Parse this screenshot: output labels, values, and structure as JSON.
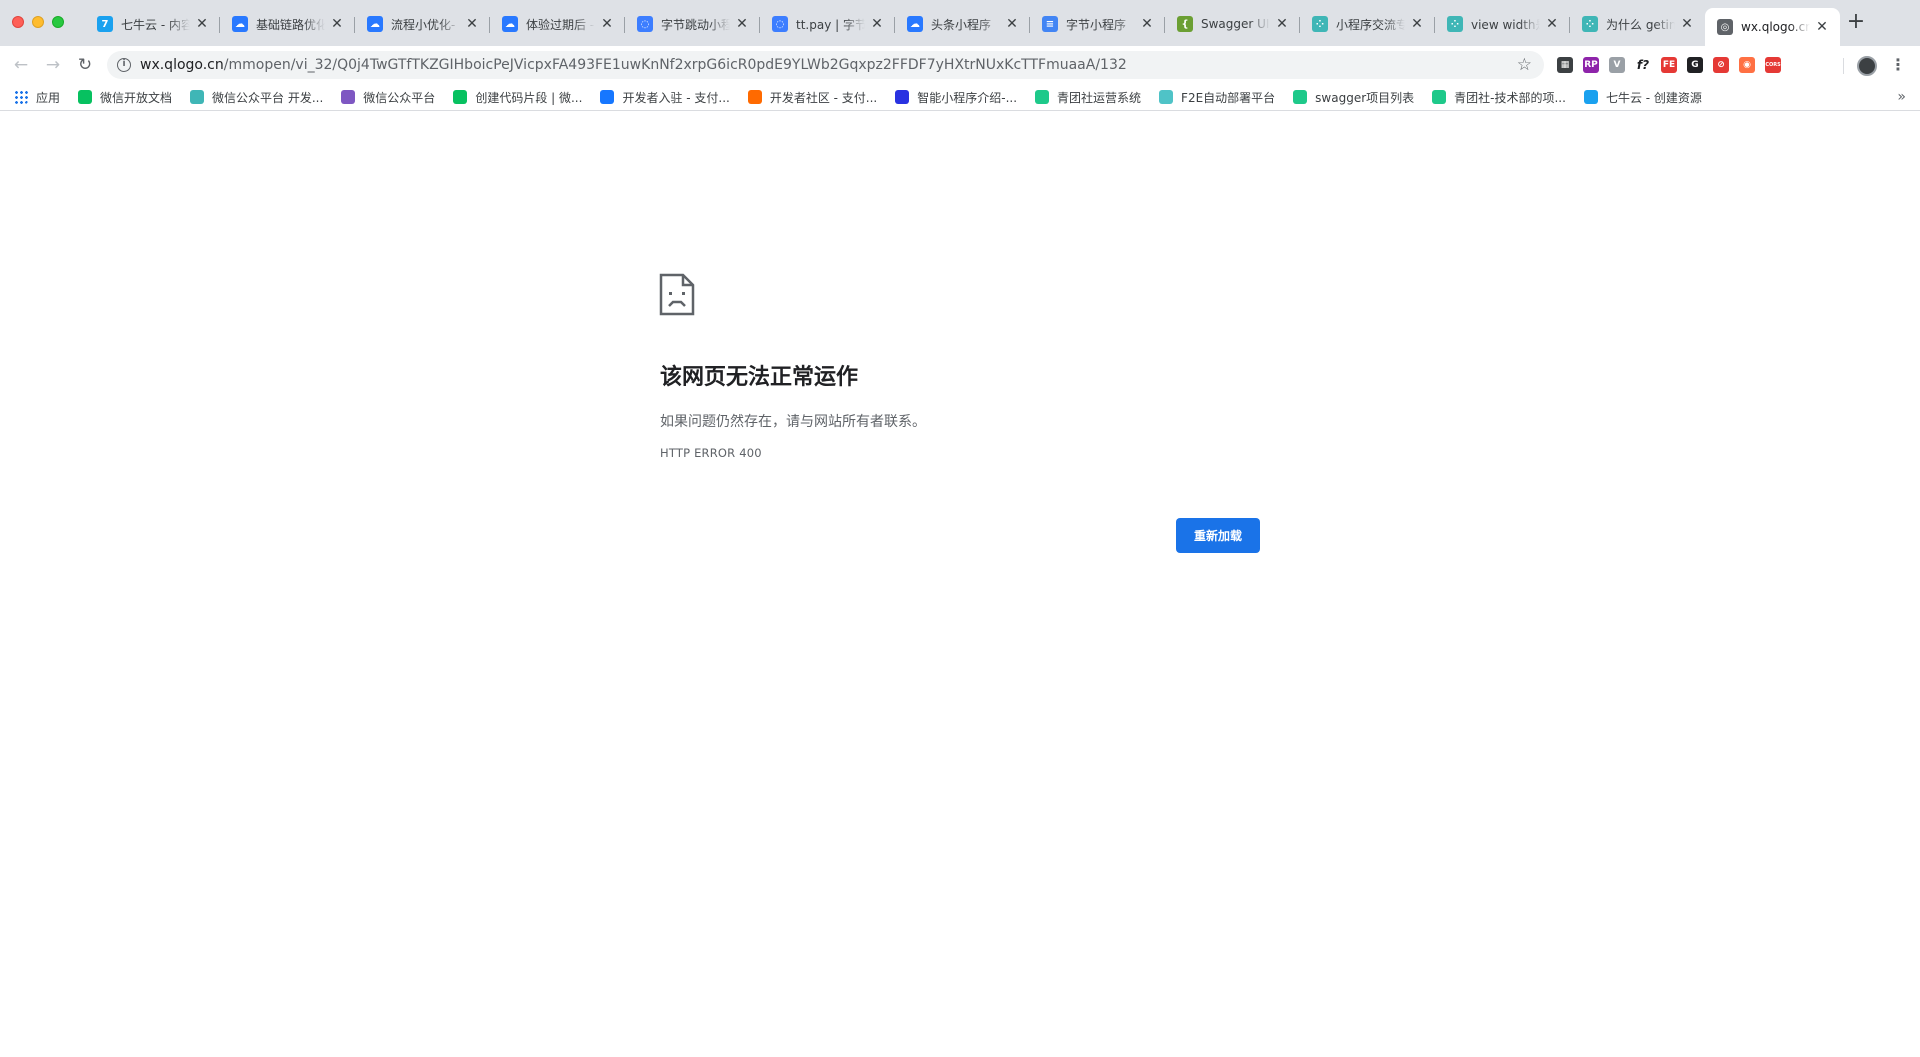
{
  "tabs": [
    {
      "title": "七牛云 - 内容",
      "fav_color": "#1aa1ef",
      "fav_glyph": "7"
    },
    {
      "title": "基础链路优化",
      "fav_color": "#2979ff",
      "fav_glyph": "☁"
    },
    {
      "title": "流程小优化-",
      "fav_color": "#2979ff",
      "fav_glyph": "☁"
    },
    {
      "title": "体验过期后 -",
      "fav_color": "#2979ff",
      "fav_glyph": "☁"
    },
    {
      "title": "字节跳动小程",
      "fav_color": "#3d7eff",
      "fav_glyph": "◌"
    },
    {
      "title": "tt.pay | 字节",
      "fav_color": "#3d7eff",
      "fav_glyph": "◌"
    },
    {
      "title": "头条小程序",
      "fav_color": "#2979ff",
      "fav_glyph": "☁"
    },
    {
      "title": "字节小程序",
      "fav_color": "#4285f4",
      "fav_glyph": "≡"
    },
    {
      "title": "Swagger UI",
      "fav_color": "#6b9f33",
      "fav_glyph": "{"
    },
    {
      "title": "小程序交流专",
      "fav_color": "#3fb6b6",
      "fav_glyph": "⁘"
    },
    {
      "title": "view width是",
      "fav_color": "#3fb6b6",
      "fav_glyph": "⁘"
    },
    {
      "title": "为什么 getin",
      "fav_color": "#3fb6b6",
      "fav_glyph": "⁘"
    },
    {
      "title": "wx.qlogo.cn",
      "fav_color": "#5f6368",
      "fav_glyph": "◎",
      "active": true
    }
  ],
  "close_glyph": "✕",
  "newtab_glyph": "+",
  "nav": {
    "back": "←",
    "forward": "→",
    "reload": "↻"
  },
  "omnibox": {
    "info_glyph": "i",
    "host": "wx.qlogo.cn",
    "path": "/mmopen/vi_32/Q0j4TwGTfTKZGIHboicPeJVicpxFA493FE1uwKnNf2xrpG6icR0pdE9YLWb2Gqxpz2FFDF7yHXtrNUxKcTTFmuaaA/132",
    "star_glyph": "☆"
  },
  "extensions": [
    {
      "name": "qr-code-extension-icon",
      "color": "#3c4043",
      "glyph": "▦"
    },
    {
      "name": "rp-extension-icon",
      "color": "#8e24aa",
      "glyph": "RP"
    },
    {
      "name": "vue-devtools-extension-icon",
      "color": "#9aa0a6",
      "glyph": "V"
    },
    {
      "name": "function-extension-icon",
      "color": "#ffffff",
      "glyph": "f?"
    },
    {
      "name": "fe-helper-extension-icon",
      "color": "#e53935",
      "glyph": "FE"
    },
    {
      "name": "dark-circle-extension-icon",
      "color": "#202124",
      "glyph": "G"
    },
    {
      "name": "red-circle-extension-icon",
      "color": "#e53935",
      "glyph": "⊘"
    },
    {
      "name": "orange-circle-extension-icon",
      "color": "#ff7043",
      "glyph": "◉"
    },
    {
      "name": "cors-extension-icon",
      "color": "#e53935",
      "glyph": "CORS"
    }
  ],
  "menu_glyph": "⋮",
  "bookmarks": [
    {
      "label": "应用",
      "color": "#1a73e8",
      "name": "apps"
    },
    {
      "label": "微信开放文档",
      "color": "#07c160",
      "name": "wechat-docs"
    },
    {
      "label": "微信公众平台 开发...",
      "color": "#3fb6b6",
      "name": "wechat-mp-dev"
    },
    {
      "label": "微信公众平台",
      "color": "#7e57c2",
      "name": "wechat-mp"
    },
    {
      "label": "创建代码片段 | 微...",
      "color": "#07c160",
      "name": "code-snippet"
    },
    {
      "label": "开发者入驻 - 支付...",
      "color": "#1677ff",
      "name": "alipay-dev-join"
    },
    {
      "label": "开发者社区 - 支付...",
      "color": "#ff6a00",
      "name": "alipay-dev-community"
    },
    {
      "label": "智能小程序介绍-...",
      "color": "#2932e1",
      "name": "baidu-smart-app"
    },
    {
      "label": "青团社运营系统",
      "color": "#1ec98a",
      "name": "qts-ops"
    },
    {
      "label": "F2E自动部署平台",
      "color": "#4fc3c7",
      "name": "f2e-deploy"
    },
    {
      "label": "swagger项目列表",
      "color": "#1ec98a",
      "name": "swagger-projects"
    },
    {
      "label": "青团社-技术部的项...",
      "color": "#1ec98a",
      "name": "qts-tech"
    },
    {
      "label": "七牛云 - 创建资源",
      "color": "#1aa1ef",
      "name": "qiniu-create"
    }
  ],
  "bookmarks_more": "»",
  "error": {
    "title": "该网页无法正常运作",
    "description": "如果问题仍然存在，请与网站所有者联系。",
    "code": "HTTP ERROR 400",
    "reload_label": "重新加载"
  }
}
